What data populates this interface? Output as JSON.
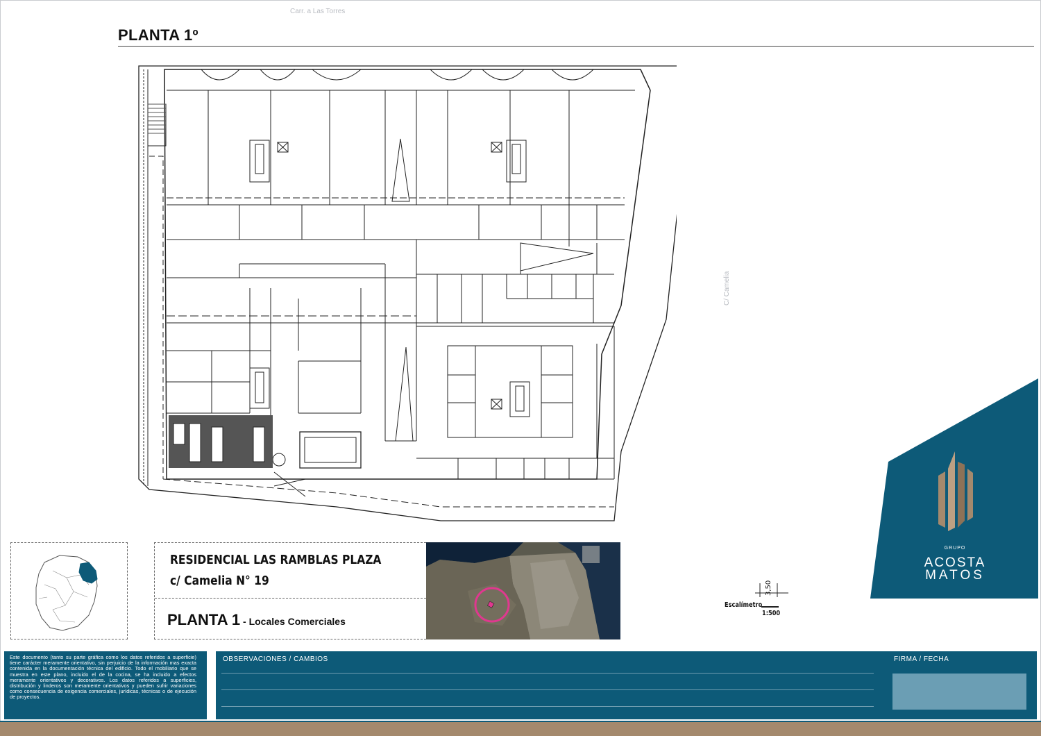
{
  "sheet": {
    "title": "PLANTA 1º",
    "street_top": "Carr. a Las Torres",
    "street_right": "C/ Camelia"
  },
  "project": {
    "name": "RESIDENCIAL LAS RAMBLAS PLAZA",
    "address": "c/ Camelia N° 19",
    "floor": "PLANTA 1",
    "floor_separator": " - ",
    "floor_use": "Locales Comerciales"
  },
  "scale": {
    "label": "Escalímetro",
    "dimension": "3,50",
    "ratio": "1:500"
  },
  "brand": {
    "group": "GRUPO",
    "line1": "ACOSTA",
    "line2": "MATOS"
  },
  "disclaimer": "Este documento (tanto su parte gráfica como los datos referidos a superficie) tiene carácter meramente orientativo, sin perjuicio de la información mas exacta contenida en la documentación técnica del edificio. Todo el mobiliario que se muestra en este plano, incluido el de la cocina, se ha incluido a efectos meramente orientativos y decorativos. Los datos referidos a superficies, distribución y linderos son meramente orientativos y pueden sufrir variaciones como consecuencia de exigencia comerciales, jurídicas, técnicas o de ejecución de proyectos.",
  "footer": {
    "observations_label": "OBSERVACIONES / CAMBIOS",
    "signature_label": "FIRMA / FECHA"
  },
  "colors": {
    "brand_blue": "#0d5a78",
    "brand_bronze": "#a4896d",
    "location_marker": "#e0388f"
  }
}
